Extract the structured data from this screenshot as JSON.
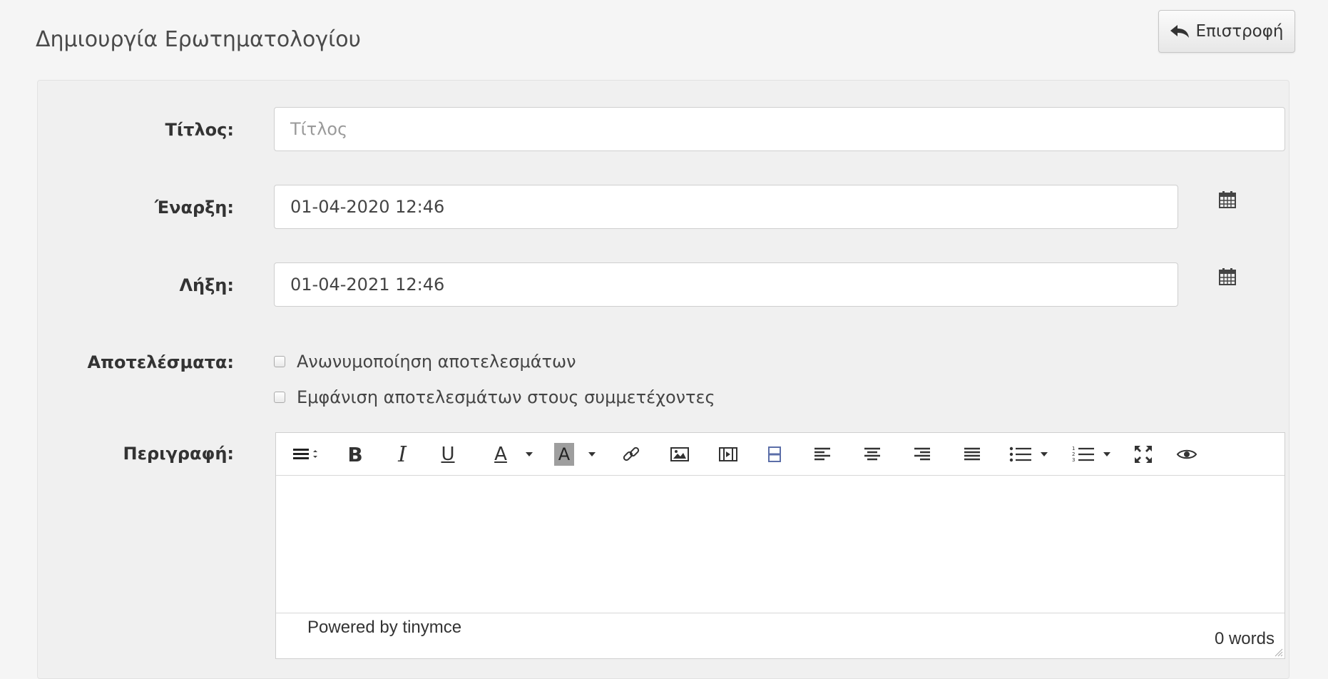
{
  "page": {
    "title": "Δημιουργία Ερωτηματολογίου",
    "back_label": "Επιστροφή"
  },
  "form": {
    "title_label": "Τίτλος:",
    "title_placeholder": "Τίτλος",
    "title_value": "",
    "start_label": "Έναρξη:",
    "start_value": "01-04-2020 12:46",
    "end_label": "Λήξη:",
    "end_value": "01-04-2021 12:46",
    "results_label": "Αποτελέσματα:",
    "anonymize_label": "Ανωνυμοποίηση αποτελεσμάτων",
    "anonymize_checked": false,
    "show_results_label": "Εμφάνιση αποτελεσμάτων στους συμμετέχοντες",
    "show_results_checked": false,
    "description_label": "Περιγραφή:"
  },
  "editor": {
    "toolbar_icons": [
      "paragraph-format-icon",
      "bold-icon",
      "italic-icon",
      "underline-icon",
      "text-color-icon",
      "highlight-color-icon",
      "link-icon",
      "image-icon",
      "media-icon",
      "template-icon",
      "align-left-icon",
      "align-center-icon",
      "align-right-icon",
      "align-justify-icon",
      "bullet-list-icon",
      "numbered-list-icon",
      "fullscreen-icon",
      "preview-icon"
    ],
    "bold_glyph": "B",
    "italic_glyph": "I",
    "underline_glyph": "U",
    "textcolor_glyph": "A",
    "highlight_glyph": "A",
    "powered_by": "Powered by tinymce",
    "word_count": "0 words"
  },
  "colors": {
    "background": "#f5f5f5",
    "panel": "#f0f0f0",
    "highlight_swatch": "#9e9e9e",
    "template_icon": "#5b6ea8"
  }
}
